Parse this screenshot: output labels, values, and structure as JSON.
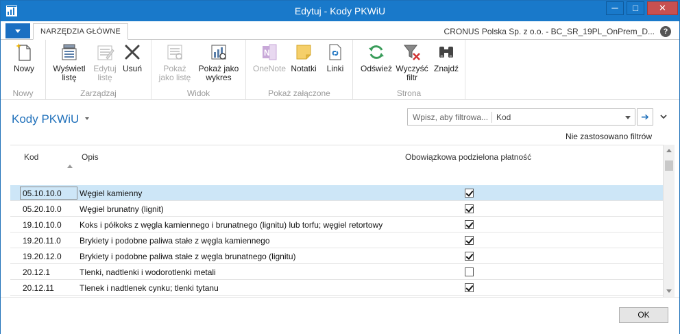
{
  "window": {
    "title": "Edytuj - Kody PKWiU",
    "minimize": "─",
    "maximize": "□",
    "close": "✕"
  },
  "ribbon_tabs": {
    "active_tab": "NARZĘDZIA GŁÓWNE",
    "company": "CRONUS Polska Sp. z o.o. - BC_SR_19PL_OnPrem_D...",
    "help": "?"
  },
  "ribbon": {
    "groups": {
      "nowy": "Nowy",
      "zarzadzaj": "Zarządzaj",
      "widok": "Widok",
      "pokaz_zalaczone": "Pokaż załączone",
      "strona": "Strona"
    },
    "buttons": {
      "nowy": "Nowy",
      "wyswietl_line1": "Wyświetl",
      "wyswietl_line2": "listę",
      "edytuj_line1": "Edytuj",
      "edytuj_line2": "listę",
      "usun": "Usuń",
      "pokaz_liste_line1": "Pokaż",
      "pokaz_liste_line2": "jako listę",
      "pokaz_wykres_line1": "Pokaż jako",
      "pokaz_wykres_line2": "wykres",
      "onenote": "OneNote",
      "notatki": "Notatki",
      "linki": "Linki",
      "odswiez": "Odśwież",
      "wyczysc_line1": "Wyczyść",
      "wyczysc_line2": "filtr",
      "znajdz": "Znajdź"
    }
  },
  "page": {
    "title": "Kody PKWiU",
    "filter_placeholder": "Wpisz, aby filtrowa...",
    "filter_field": "Kod",
    "filter_go": "➔",
    "filter_status": "Nie zastosowano filtrów"
  },
  "grid": {
    "columns": {
      "kod": "Kod",
      "opis": "Opis",
      "platnosc": "Obowiązkowa podzielona płatność"
    },
    "rows": [
      {
        "kod": "05.10.10.0",
        "opis": "Węgiel kamienny",
        "checked": true
      },
      {
        "kod": "05.20.10.0",
        "opis": "Węgiel brunatny (lignit)",
        "checked": true
      },
      {
        "kod": "19.10.10.0",
        "opis": "Koks i półkoks z węgla kamiennego i brunatnego (lignitu) lub torfu; węgiel retortowy",
        "checked": true
      },
      {
        "kod": "19.20.11.0",
        "opis": "Brykiety i podobne paliwa stałe z węgla kamiennego",
        "checked": true
      },
      {
        "kod": "19.20.12.0",
        "opis": "Brykiety i podobne paliwa stałe z węgla brunatnego (lignitu)",
        "checked": true
      },
      {
        "kod": "20.12.1",
        "opis": "Tlenki, nadtlenki i wodorotlenki metali",
        "checked": false
      },
      {
        "kod": "20.12.11",
        "opis": "Tlenek i nadtlenek cynku; tlenki tytanu",
        "checked": true
      }
    ]
  },
  "footer": {
    "ok": "OK"
  },
  "colors": {
    "titlebar": "#1979ca",
    "accent": "#1e6fba",
    "selected_row": "#cde6f7"
  }
}
